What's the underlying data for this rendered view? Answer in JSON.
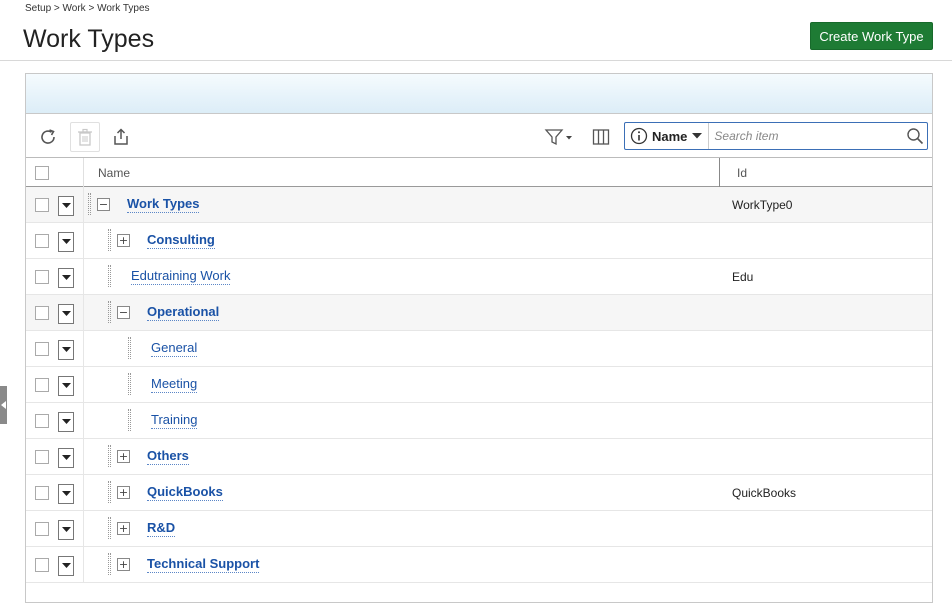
{
  "breadcrumb": "Setup > Work > Work Types",
  "page_title": "Work Types",
  "create_button": "Create Work Type",
  "toolbar": {
    "search_field": "Name",
    "search_placeholder": "Search item"
  },
  "columns": {
    "name": "Name",
    "id": "Id"
  },
  "rows": [
    {
      "name": "Work Types",
      "id": "WorkType0",
      "expander": "−",
      "bold": true
    },
    {
      "name": "Consulting",
      "id": "",
      "expander": "+",
      "bold": true
    },
    {
      "name": "Edutraining Work",
      "id": "Edu",
      "expander": "",
      "bold": false
    },
    {
      "name": "Operational",
      "id": "",
      "expander": "−",
      "bold": true
    },
    {
      "name": "General",
      "id": "",
      "expander": "",
      "bold": false
    },
    {
      "name": "Meeting",
      "id": "",
      "expander": "",
      "bold": false
    },
    {
      "name": "Training",
      "id": "",
      "expander": "",
      "bold": false
    },
    {
      "name": "Others",
      "id": "",
      "expander": "+",
      "bold": true
    },
    {
      "name": "QuickBooks",
      "id": "QuickBooks",
      "expander": "+",
      "bold": true
    },
    {
      "name": "R&D",
      "id": "",
      "expander": "+",
      "bold": true
    },
    {
      "name": "Technical Support",
      "id": "",
      "expander": "+",
      "bold": true
    }
  ]
}
